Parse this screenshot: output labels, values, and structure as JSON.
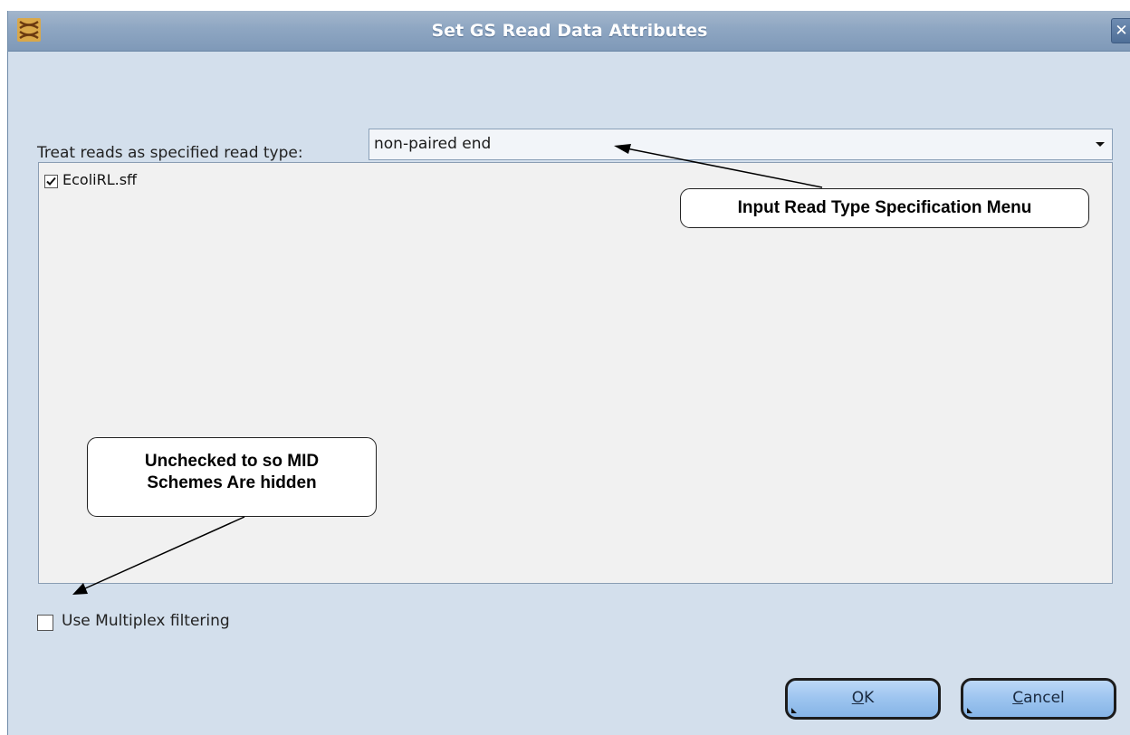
{
  "window": {
    "title": "Set GS Read Data Attributes",
    "close_glyph": "✕"
  },
  "read_type": {
    "label": "Treat reads as specified read type:",
    "selected_value": "non-paired end"
  },
  "files": [
    {
      "name": "EcoliRL.sff",
      "checked": true
    }
  ],
  "multiplex": {
    "label": "Use Multiplex filtering",
    "checked": false
  },
  "buttons": {
    "ok": {
      "mnemonic": "O",
      "rest": "K"
    },
    "cancel": {
      "mnemonic": "C",
      "rest": "ancel"
    }
  },
  "callouts": {
    "read_type_menu": "Input Read Type Specification Menu",
    "mid_line1": "Unchecked to so MID",
    "mid_line2": "Schemes Are hidden"
  },
  "icons": {
    "app": "dna-helix-icon",
    "close": "close-icon",
    "dropdown": "chevron-down-icon",
    "check": "checkmark-icon"
  }
}
